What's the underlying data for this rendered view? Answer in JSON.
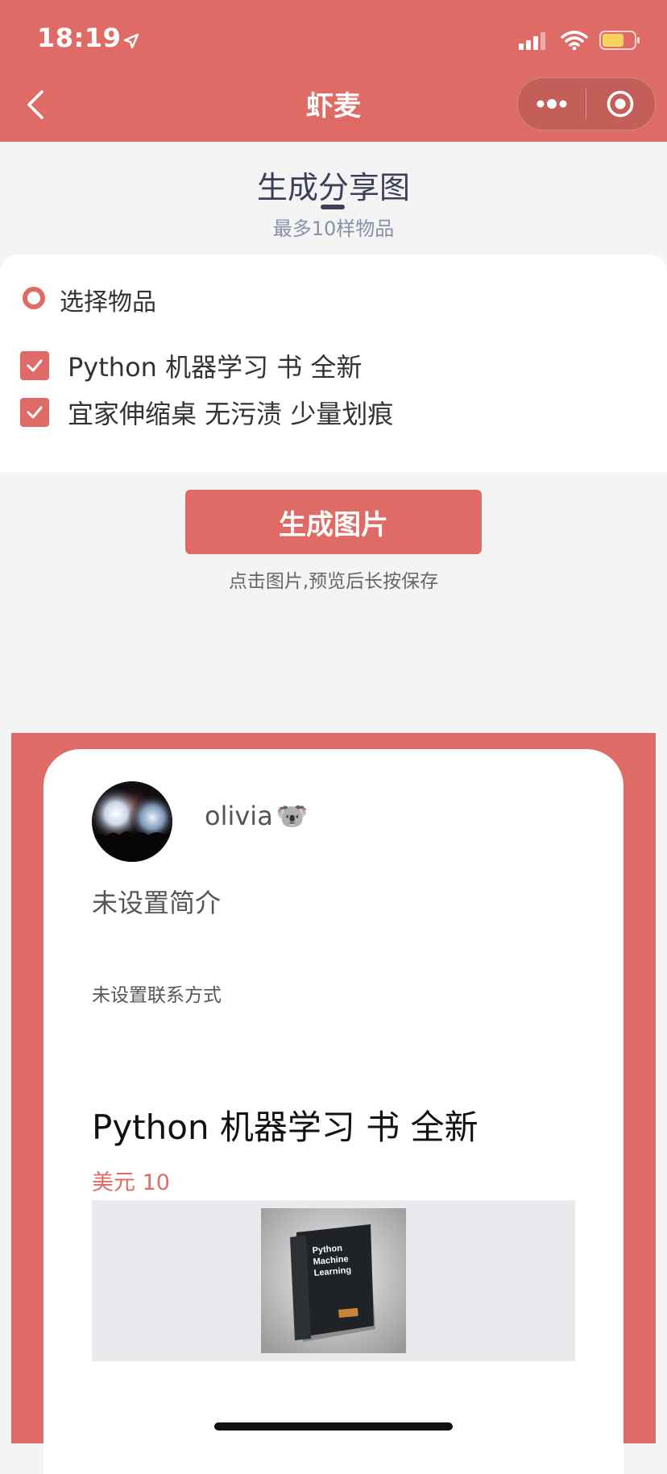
{
  "status_bar": {
    "time": "18:19"
  },
  "nav": {
    "title": "虾麦"
  },
  "page": {
    "title": "生成分享图",
    "subtitle": "最多10样物品"
  },
  "select": {
    "label": "选择物品",
    "items": [
      {
        "label": "Python 机器学习 书 全新",
        "checked": true
      },
      {
        "label": "宜家伸缩桌 无污渍 少量划痕",
        "checked": true
      }
    ]
  },
  "actions": {
    "generate_label": "生成图片",
    "hint": "点击图片,预览后长按保存"
  },
  "preview": {
    "username": "olivia",
    "username_emoji": "🐨",
    "bio": "未设置简介",
    "contact": "未设置联系方式",
    "item": {
      "title": "Python 机器学习 书 全新",
      "price": "美元 10",
      "cover_text": [
        "Python",
        "Machine",
        "Learning"
      ]
    }
  },
  "colors": {
    "accent": "#df6b66",
    "heading": "#3b3f5a",
    "subtitle": "#8a90a8"
  }
}
